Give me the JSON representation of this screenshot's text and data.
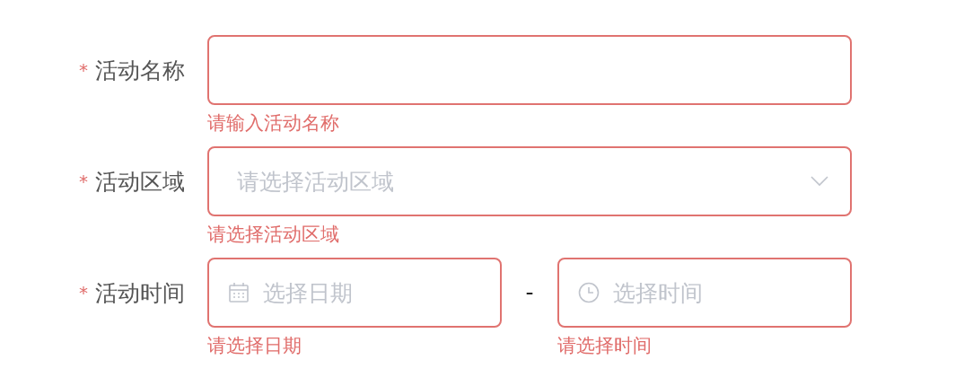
{
  "form": {
    "items": [
      {
        "kind": "text",
        "marker": "*",
        "label": "活动名称",
        "error": "请输入活动名称"
      },
      {
        "kind": "select",
        "marker": "*",
        "label": "活动区域",
        "placeholder": "请选择活动区域",
        "error": "请选择活动区域"
      },
      {
        "kind": "datetime",
        "marker": "*",
        "label": "活动时间",
        "separator": "-",
        "parts": [
          {
            "kind": "date",
            "placeholder": "选择日期",
            "error": "请选择日期"
          },
          {
            "kind": "time",
            "placeholder": "选择时间",
            "error": "请选择时间"
          }
        ]
      }
    ]
  }
}
